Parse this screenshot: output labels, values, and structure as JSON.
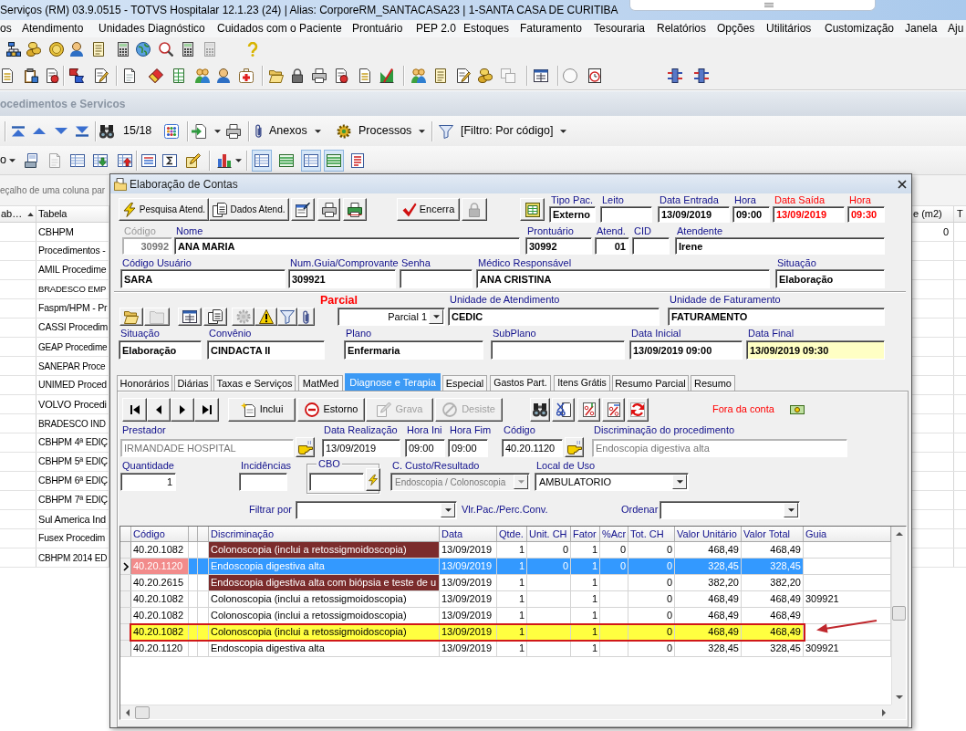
{
  "window": {
    "title": "Serviços (RM) 03.9.0515 - TOTVS Hospitalar 12.1.23 (24) | Alias: CorporeRM_SANTACASA23 | 1-SANTA CASA DE CURITIBA"
  },
  "menu": [
    "os",
    "Atendimento",
    "Unidades Diagnóstico",
    "Cuidados com o Paciente",
    "Prontuário",
    "PEP 2.0",
    "Estoques",
    "Faturamento",
    "Tesouraria",
    "Relatórios",
    "Opções",
    "Utilitários",
    "Customização",
    "Janela",
    "Aju"
  ],
  "toolbar_1": [
    {
      "disabled": false
    },
    {
      "disabled": false
    },
    {
      "disabled": false
    },
    {
      "disabled": false
    },
    {
      "disabled": false
    },
    {
      "disabled": false
    },
    {
      "disabled": false
    },
    {
      "disabled": false
    },
    {
      "disabled": false
    },
    {
      "disabled": true
    },
    {
      "disabled": false
    }
  ],
  "toolbar_2": [
    {
      "disabled": false
    },
    {
      "disabled": false
    },
    {
      "disabled": false
    },
    {
      "disabled": false
    },
    {
      "disabled": false
    },
    {
      "disabled": false
    },
    {
      "disabled": false
    },
    {
      "disabled": false
    },
    {
      "disabled": false
    },
    {
      "disabled": false
    },
    {
      "disabled": false
    },
    {
      "disabled": false
    },
    {
      "disabled": false
    },
    {
      "disabled": false
    },
    {
      "disabled": false
    },
    {
      "disabled": false
    },
    {
      "disabled": false
    },
    {
      "disabled": false
    },
    {
      "disabled": false
    },
    {
      "disabled": false
    },
    {
      "disabled": false
    },
    {
      "disabled": true
    },
    {
      "disabled": false
    },
    {
      "disabled": false
    },
    {
      "disabled": false
    },
    {
      "disabled": false
    },
    {
      "disabled": false
    }
  ],
  "child_window": {
    "title": "ocedimentos e Servicos",
    "record_counter": "15/18",
    "menu_buttons": [
      "Anexos",
      "Processos",
      "[Filtro: Por código]"
    ],
    "cut_button": "o",
    "view_buttons": [
      {
        "disabled": false,
        "pressed": false
      },
      {
        "disabled": true,
        "pressed": false
      },
      {
        "disabled": false,
        "pressed": false
      },
      {
        "disabled": false,
        "pressed": false
      },
      {
        "disabled": false,
        "pressed": false
      },
      {
        "disabled": false,
        "pressed": false
      },
      {
        "disabled": false,
        "pressed": false
      },
      {
        "disabled": false,
        "pressed": false
      },
      {
        "disabled": false,
        "pressed": false
      },
      {
        "disabled": false,
        "pressed": true
      },
      {
        "disabled": false,
        "pressed": false
      },
      {
        "disabled": false,
        "pressed": true
      },
      {
        "disabled": false,
        "pressed": true
      },
      {
        "disabled": false,
        "pressed": false
      }
    ],
    "group_hint": "eçalho de uma coluna par",
    "grid": {
      "columns": [
        "ab…",
        "Tabela"
      ],
      "rows": [
        "CBHPM",
        "Procedimentos -",
        "AMIL Procedime",
        "BRADESCO EMP",
        "Faspm/HPM - Pr",
        "CASSI Procedim",
        "GEAP Procedime",
        "SANEPAR Proce",
        "UNIMED Proced",
        "VOLVO Procedi",
        "BRADESCO IND",
        "CBHPM 4ª EDIÇ",
        "CBHPM 5ª EDIÇ",
        "CBHPM 6ª EDIÇ",
        "CBHPM 7ª EDIÇ",
        "Sul America Ind",
        "Fusex Procedim",
        "CBHPM 2014 ED"
      ],
      "right_columns": [
        "e (m2)",
        "T"
      ],
      "right_cells": [
        "0"
      ]
    }
  },
  "dialog": {
    "title": "Elaboração de Contas",
    "action_buttons": [
      {
        "label": "Pesquisa Atend.",
        "disabled": false
      },
      {
        "label": "Dados Atend.",
        "disabled": false
      },
      {
        "disabled": false
      },
      {
        "disabled": false
      },
      {
        "disabled": false
      },
      {
        "label": "Encerra",
        "disabled": false
      },
      {
        "disabled": true
      },
      {
        "disabled": false
      }
    ],
    "visit_fields": [
      {
        "label": "Tipo Pac.",
        "value": "Externo",
        "alert": false
      },
      {
        "label": "Leito",
        "alert": false
      },
      {
        "label": "Data Entrada",
        "value": "13/09/2019",
        "alert": false
      },
      {
        "label": "Hora",
        "value": "09:00",
        "alert": false
      },
      {
        "label": "Data Saída",
        "value": "13/09/2019",
        "alert": true
      },
      {
        "label": "Hora",
        "value": "09:30",
        "alert": true
      }
    ],
    "patient_fields": [
      {
        "kind": "number",
        "label": "Código",
        "value": "30992",
        "disabled": true
      },
      {
        "kind": "text",
        "label": "Nome",
        "value": "ANA MARIA",
        "disabled": false
      },
      {
        "kind": "text",
        "label": "Prontuário",
        "value": "30992",
        "disabled": false
      },
      {
        "kind": "number",
        "label": "Atend.",
        "value": "01",
        "disabled": false
      },
      {
        "kind": "text",
        "label": "CID",
        "disabled": false
      },
      {
        "kind": "text",
        "label": "Atendente",
        "value": "Irene",
        "disabled": false
      }
    ],
    "account_fields": [
      {
        "label": "Código Usuário",
        "value": "SARA"
      },
      {
        "label": "Num.Guia/Comprovante",
        "value": "309921"
      },
      {
        "label": "Senha"
      },
      {
        "label": "Médico Responsável",
        "value": "ANA CRISTINA"
      },
      {
        "label": "Situação",
        "value": "Elaboração"
      }
    ],
    "tool_buttons": [
      {
        "disabled": false
      },
      {
        "disabled": true
      },
      {
        "disabled": false
      },
      {
        "disabled": false
      },
      {
        "disabled": true
      },
      {
        "disabled": false
      },
      {
        "disabled": false
      },
      {
        "disabled": false
      }
    ],
    "partial": {
      "label": "Parcial",
      "value": "Parcial 1"
    },
    "unit_fields": [
      {
        "label": "Unidade de Atendimento",
        "value": "CEDIC"
      },
      {
        "label": "Unidade de Faturamento",
        "value": "FATURAMENTO"
      }
    ],
    "plan_fields": [
      {
        "label": "Situação",
        "value": "Elaboração",
        "highlighted": false
      },
      {
        "label": "Convênio",
        "value": "CINDACTA II",
        "highlighted": false
      },
      {
        "label": "Plano",
        "value": "Enfermaria",
        "highlighted": false
      },
      {
        "label": "SubPlano",
        "highlighted": false
      },
      {
        "label": "Data Inicial",
        "value": "13/09/2019 09:00",
        "highlighted": false
      },
      {
        "label": "Data Final",
        "value": "13/09/2019 09:30",
        "highlighted": true
      }
    ],
    "tabs": [
      {
        "label": "Honorários",
        "selected": false
      },
      {
        "label": "Diárias",
        "selected": false
      },
      {
        "label": "Taxas e Serviços",
        "selected": false
      },
      {
        "label": "MatMed",
        "selected": false
      },
      {
        "label": "Diagnose e Terapia",
        "selected": true
      },
      {
        "label": "Especial",
        "selected": false
      },
      {
        "label": "Gastos Part.",
        "selected": false
      },
      {
        "label": "Itens Grátis",
        "selected": false
      },
      {
        "label": "Resumo Parcial",
        "selected": false
      },
      {
        "label": "Resumo",
        "selected": false
      }
    ],
    "nav_buttons": [
      {
        "label": "Inclui",
        "disabled": false
      },
      {
        "label": "Estorno",
        "disabled": false
      },
      {
        "label": "Grava",
        "disabled": true
      },
      {
        "label": "Desiste",
        "disabled": true
      }
    ],
    "outside_account": "Fora da conta",
    "procedure_fields": [
      {
        "kind": "lookup",
        "label": "Prestador",
        "value": "IRMANDADE HOSPITAL",
        "disabled": true
      },
      {
        "kind": "text",
        "label": "Data Realização",
        "value": "13/09/2019",
        "disabled": false
      },
      {
        "kind": "text",
        "label": "Hora Ini",
        "value": "09:00",
        "disabled": false
      },
      {
        "kind": "text",
        "label": "Hora Fim",
        "value": "09:00",
        "disabled": false
      },
      {
        "kind": "lookup",
        "label": "Código",
        "value": "40.20.1120",
        "disabled": false
      },
      {
        "kind": "text",
        "label": "Discriminação do procedimento",
        "value": "Endoscopia digestiva alta",
        "disabled": true
      }
    ],
    "detail_fields": [
      {
        "kind": "number",
        "label": "Quantidade",
        "value": "1",
        "disabled": false
      },
      {
        "kind": "text",
        "label": "Incidências",
        "disabled": false
      },
      {
        "kind": "group",
        "label": "CBO",
        "disabled": false
      },
      {
        "kind": "combo",
        "label": "C. Custo/Resultado",
        "value": "Endoscopia / Colonoscopia",
        "disabled": true
      },
      {
        "kind": "combo",
        "label": "Local de Uso",
        "value": "AMBULATORIO",
        "disabled": false
      }
    ],
    "filter": {
      "label": "Filtrar por",
      "note": "Vlr.Pac./Perc.Conv.",
      "order_label": "Ordenar"
    },
    "grid": {
      "columns": [
        "Código",
        "Discriminação",
        "Data",
        "Qtde.",
        "Unit. CH",
        "Fator",
        "%Acr",
        "Tot. CH",
        "Valor Unitário",
        "Valor Total",
        "Guia"
      ],
      "rows": [
        {
          "code": "40.20.1082",
          "description": "Colonoscopia (inclui a retossigmoidoscopia)",
          "color": "#7b2c2c",
          "date": "13/09/2019",
          "qty": "1",
          "unit_ch": "0",
          "factor": "1",
          "acr": "0",
          "tot_ch": "0",
          "unit_value": "468,49",
          "total_value": "468,49",
          "selected": false,
          "highlighted": false,
          "annotated": false
        },
        {
          "code": "40.20.1120",
          "description": "Endoscopia digestiva alta",
          "date": "13/09/2019",
          "qty": "1",
          "unit_ch": "0",
          "factor": "1",
          "acr": "0",
          "tot_ch": "0",
          "unit_value": "328,45",
          "total_value": "328,45",
          "selected": true,
          "highlighted": false,
          "annotated": false
        },
        {
          "code": "40.20.2615",
          "description": "Endoscopia digestiva alta com biópsia e teste de u",
          "color": "#7b2c2c",
          "date": "13/09/2019",
          "qty": "1",
          "factor": "1",
          "tot_ch": "0",
          "unit_value": "382,20",
          "total_value": "382,20",
          "selected": false,
          "highlighted": false,
          "annotated": false
        },
        {
          "code": "40.20.1082",
          "description": "Colonoscopia (inclui a retossigmoidoscopia)",
          "date": "13/09/2019",
          "qty": "1",
          "factor": "1",
          "tot_ch": "0",
          "unit_value": "468,49",
          "total_value": "468,49",
          "guide": "309921",
          "selected": false,
          "highlighted": false,
          "annotated": false
        },
        {
          "code": "40.20.1082",
          "description": "Colonoscopia (inclui a retossigmoidoscopia)",
          "date": "13/09/2019",
          "qty": "1",
          "factor": "1",
          "tot_ch": "0",
          "unit_value": "468,49",
          "total_value": "468,49",
          "selected": false,
          "highlighted": false,
          "annotated": false
        },
        {
          "code": "40.20.1082",
          "description": "Colonoscopia (inclui a retossigmoidoscopia)",
          "date": "13/09/2019",
          "qty": "1",
          "factor": "1",
          "tot_ch": "0",
          "unit_value": "468,49",
          "total_value": "468,49",
          "selected": false,
          "highlighted": true,
          "annotated": true
        },
        {
          "code": "40.20.1120",
          "description": "Endoscopia digestiva alta",
          "date": "13/09/2019",
          "qty": "1",
          "factor": "1",
          "tot_ch": "0",
          "unit_value": "328,45",
          "total_value": "328,45",
          "guide": "309921",
          "selected": false,
          "highlighted": false,
          "annotated": false
        }
      ]
    }
  }
}
